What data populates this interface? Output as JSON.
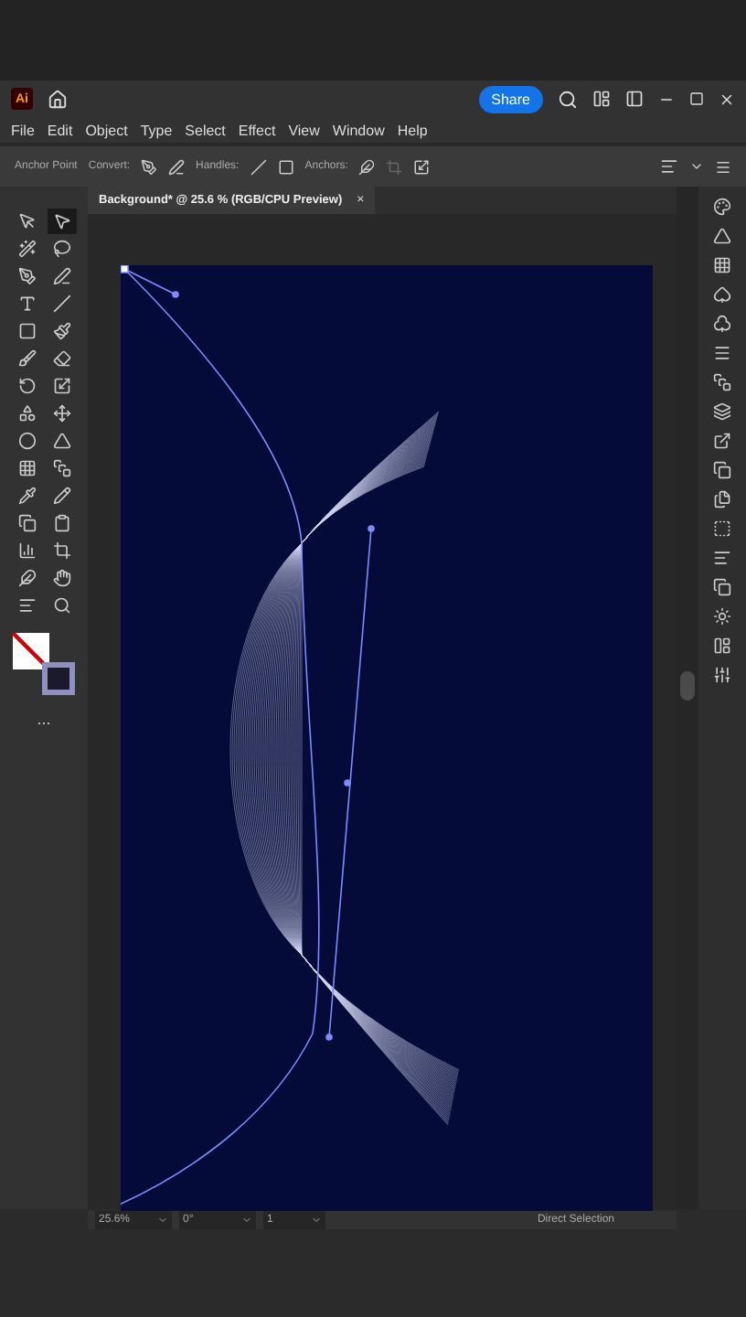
{
  "title_bar": {
    "logo": "Ai",
    "share": "Share"
  },
  "menu": [
    "File",
    "Edit",
    "Object",
    "Type",
    "Select",
    "Effect",
    "View",
    "Window",
    "Help"
  ],
  "control_bar": {
    "tool": "Anchor Point",
    "convert": "Convert:",
    "handles": "Handles:",
    "anchors": "Anchors:"
  },
  "document_tab": {
    "title": "Background* @ 25.6 % (RGB/CPU Preview)",
    "close": "×"
  },
  "tools": [
    {
      "selected": false
    },
    {
      "selected": true
    },
    {
      "selected": false
    },
    {
      "selected": false
    },
    {
      "selected": false
    },
    {
      "selected": false
    },
    {
      "selected": false
    },
    {
      "selected": false
    },
    {
      "selected": false
    },
    {
      "selected": false
    },
    {
      "selected": false
    },
    {
      "selected": false
    },
    {
      "selected": false
    },
    {
      "selected": false
    },
    {
      "selected": false
    },
    {
      "selected": false
    },
    {
      "selected": false
    },
    {
      "selected": false
    },
    {
      "selected": false
    },
    {
      "selected": false
    },
    {
      "selected": false
    },
    {
      "selected": false
    },
    {
      "selected": false
    },
    {
      "selected": false
    },
    {
      "selected": false
    },
    {
      "selected": false
    },
    {
      "selected": false
    },
    {
      "selected": false
    },
    {
      "selected": false
    },
    {
      "selected": false
    }
  ],
  "tools_more": "...",
  "status_bar": {
    "zoom": "25.6%",
    "rotation": "0°",
    "artboard": "1",
    "current_tool": "Direct Selection"
  }
}
